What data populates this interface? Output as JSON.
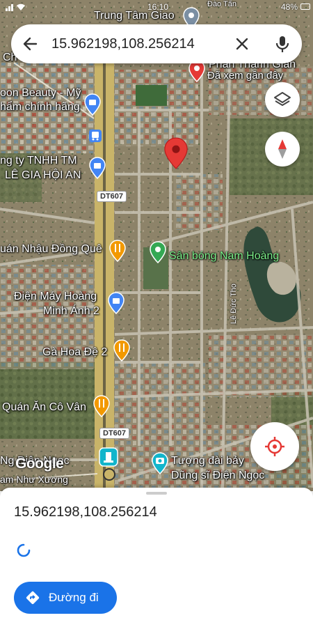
{
  "status_bar": {
    "time": "16:10",
    "battery": "48%"
  },
  "search": {
    "query": "15.962198,108.256214"
  },
  "map": {
    "labels": {
      "trung_tam_giao": "Trung Tâm Giao",
      "dao_tan": "Đào Tấn",
      "ch": "Ch",
      "phan_thanh_gian": "Phan Thanh Gian",
      "da_xem_gan_day": "Đã xem gần đây",
      "beauty_1": "oon Beauty - Mỹ",
      "beauty_2": "hẩm chính hãng",
      "company_1": "ng ty TNHH TM",
      "company_2": "LÊ GIA HỘI AN",
      "quan_nhau": "uán Nhậu Đồng Quê",
      "san_bong": "Sân bóng Nam Hoàng",
      "dien_may_1": "Điện Máy Hoàng",
      "dien_may_2": "Minh Ánh 2",
      "ga_hoa": "Gà Hoa Đệ 2",
      "quan_an": "Quán Ăn Cô Vân",
      "dien_ngoc": "Ng       Điện Ngọc",
      "tuong_dai_1": "Tượng đài bảy",
      "tuong_dai_2": "Dũng sĩ Điện Ngọc",
      "nhu_xuong": "am Như Xương",
      "le_duc_tho": "Lê Đức Thọ",
      "dt607_top": "DT607",
      "dt607_bottom": "DT607",
      "google": "Google"
    }
  },
  "place_sheet": {
    "coordinates": "15.962198,108.256214",
    "directions_label": "Đường đi"
  },
  "colors": {
    "accent": "#1a73e8",
    "pin_red": "#e53935",
    "poi_orange": "#f29900",
    "poi_blue": "#4285f4",
    "poi_green": "#34a853",
    "poi_teal": "#12b5cb"
  }
}
